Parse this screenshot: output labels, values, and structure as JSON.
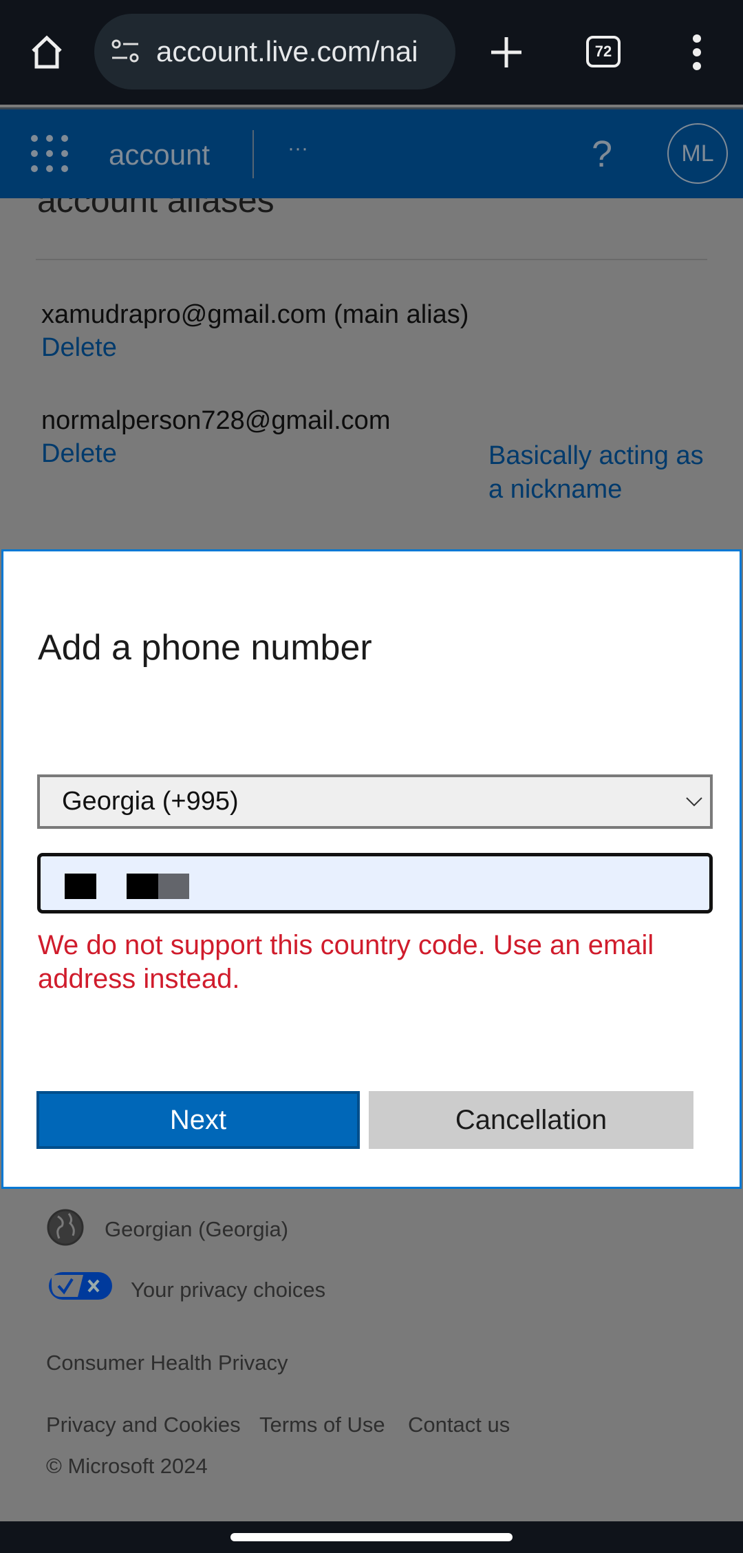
{
  "browser": {
    "url": "account.live.com/nai",
    "tab_count": "72"
  },
  "header": {
    "app_name": "account",
    "more": "···",
    "help": "?",
    "avatar_initials": "ML",
    "brand_color": "#0067b8"
  },
  "page": {
    "section_title": "account aliases",
    "aliases": [
      {
        "email": "xamudrapro@gmail.com (main alias)",
        "delete": "Delete"
      },
      {
        "email": "normalperson728@gmail.com",
        "delete": "Delete",
        "note": "Basically acting as a nickname"
      }
    ]
  },
  "dialog": {
    "title": "Add a phone number",
    "country_select": "Georgia (+995)",
    "phone_value": "",
    "error": "We do not support this country code. Use an email address instead.",
    "next": "Next",
    "cancel": "Cancellation",
    "error_color": "#d01c2c"
  },
  "footer": {
    "language": "Georgian (Georgia)",
    "privacy_choices": "Your privacy choices",
    "consumer_health": "Consumer Health Privacy",
    "links": [
      "Privacy and Cookies",
      "Terms of Use",
      "Contact us"
    ],
    "copyright": "© Microsoft 2024"
  }
}
